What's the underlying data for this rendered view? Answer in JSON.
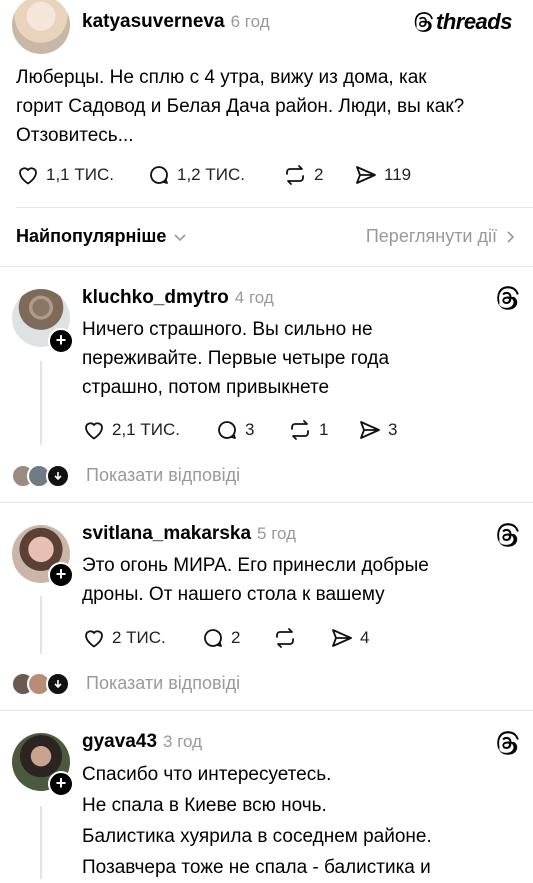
{
  "post": {
    "username": "katyasuverneva",
    "time": "6 год",
    "brand": "threads",
    "text_line1": "Люберцы. Не сплю с 4 утра, вижу из дома, как",
    "text_line2": "горит Садовод и Белая Дача район. Люди, вы как?",
    "text_line3": "Отзовитесь...",
    "likes": "1,1 ТИС.",
    "comments": "1,2 ТИС.",
    "reposts": "2",
    "shares": "119"
  },
  "sort": {
    "label": "Найпопулярніше",
    "activity_link": "Переглянути дії"
  },
  "replies": [
    {
      "username": "kluchko_dmytro",
      "time": "4 год",
      "lines": [
        "Ничего страшного. Вы сильно не",
        "переживайте. Первые четыре года",
        "страшно, потом привыкнете"
      ],
      "likes": "2,1 ТИС.",
      "comments": "3",
      "reposts": "1",
      "shares": "3",
      "show_replies": "Показати відповіді"
    },
    {
      "username": "svitlana_makarska",
      "time": "5 год",
      "lines": [
        "Это огонь МИРА. Его принесли добрые",
        "дроны. От нашего стола к вашему"
      ],
      "likes": "2 ТИС.",
      "comments": "2",
      "reposts": "",
      "shares": "4",
      "show_replies": "Показати відповіді"
    },
    {
      "username": "gyava43",
      "time": "3 год",
      "lines": [
        "Спасибо что интересуетесь.",
        "Не спала в Киеве всю ночь.",
        "Балистика хуярила в соседнем районе.",
        "Позавчера тоже не спала - балистика и"
      ]
    }
  ]
}
